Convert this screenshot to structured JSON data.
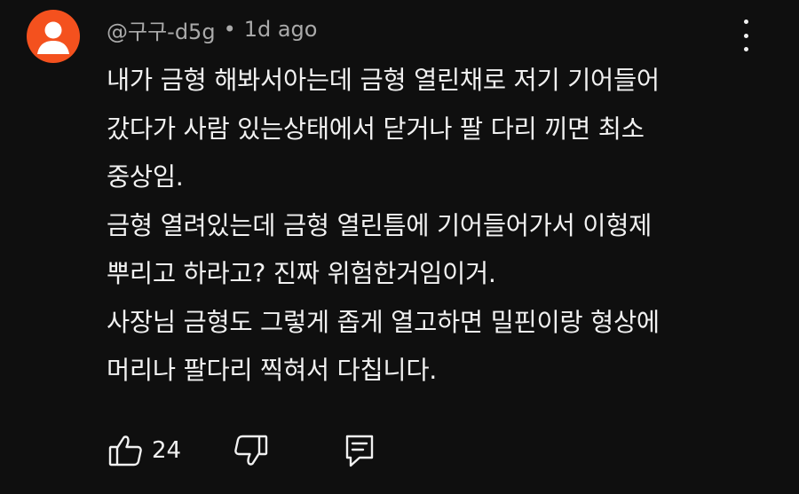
{
  "comment": {
    "author": "@구구-d5g",
    "separator": "•",
    "time": "1d ago",
    "lines": [
      "내가 금형 해봐서아는데 금형 열린채로 저기 기어들어",
      "갔다가 사람 있는상태에서 닫거나 팔 다리 끼면 최소",
      "중상임.",
      "금형 열려있는데 금형 열린틈에 기어들어가서 이형제",
      "뿌리고 하라고? 진짜 위험한거임이거.",
      "사장님 금형도 그렇게 좁게 열고하면 밀핀이랑 형상에",
      "머리나 팔다리 찍혀서 다칩니다."
    ],
    "like_count": "24"
  },
  "icons": {
    "avatar": "default-avatar-icon",
    "menu": "more-vert-icon",
    "like": "thumbs-up-icon",
    "dislike": "thumbs-down-icon",
    "reply": "reply-icon"
  },
  "colors": {
    "background": "#0f0f0f",
    "avatar": "#f4511e",
    "text": "#f1f1f1",
    "meta": "#aaaaaa"
  }
}
